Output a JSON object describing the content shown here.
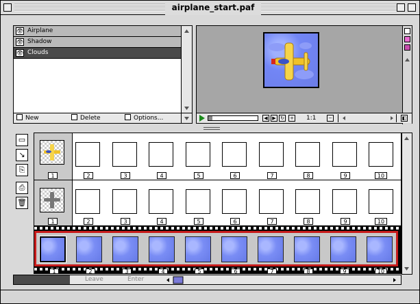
{
  "window": {
    "title": "airplane_start.paf"
  },
  "layers": {
    "items": [
      {
        "name": "Airplane",
        "selected": false
      },
      {
        "name": "Shadow",
        "selected": false
      },
      {
        "name": "Clouds",
        "selected": true
      }
    ],
    "buttons": {
      "new_label": "New",
      "delete_label": "Delete",
      "options_label": "Options..."
    }
  },
  "preview": {
    "zoom_label": "1:1"
  },
  "frames": {
    "row1_numbers": [
      "1",
      "2",
      "3",
      "4",
      "5",
      "6",
      "7",
      "8",
      "9",
      "10"
    ],
    "row2_numbers": [
      "1",
      "2",
      "3",
      "4",
      "5",
      "6",
      "7",
      "8",
      "9",
      "10"
    ],
    "film_numbers": [
      "1",
      "2",
      "3",
      "4",
      "5",
      "6",
      "7",
      "8",
      "9",
      "10"
    ]
  },
  "bottom": {
    "leave_label": "Leave",
    "enter_label": "Enter"
  },
  "colors": {
    "selection_border": "#c81c1c",
    "sky": "#7286f5"
  }
}
